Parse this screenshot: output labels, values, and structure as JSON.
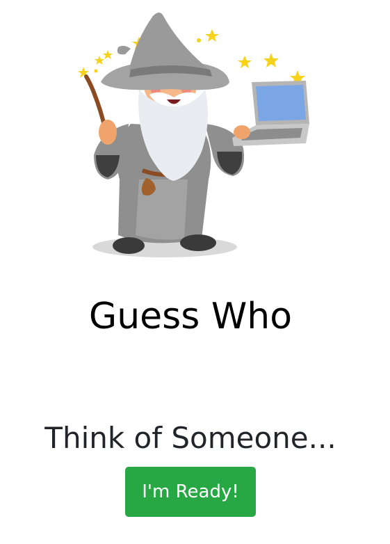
{
  "app": {
    "title": "Guess Who",
    "prompt": "Think of Someone...",
    "ready_button_label": "I'm Ready!"
  },
  "illustration": {
    "icon": "wizard-with-laptop-icon"
  },
  "colors": {
    "button_bg": "#28a745",
    "button_text": "#ffffff",
    "title_text": "#000000",
    "prompt_text": "#212529"
  }
}
